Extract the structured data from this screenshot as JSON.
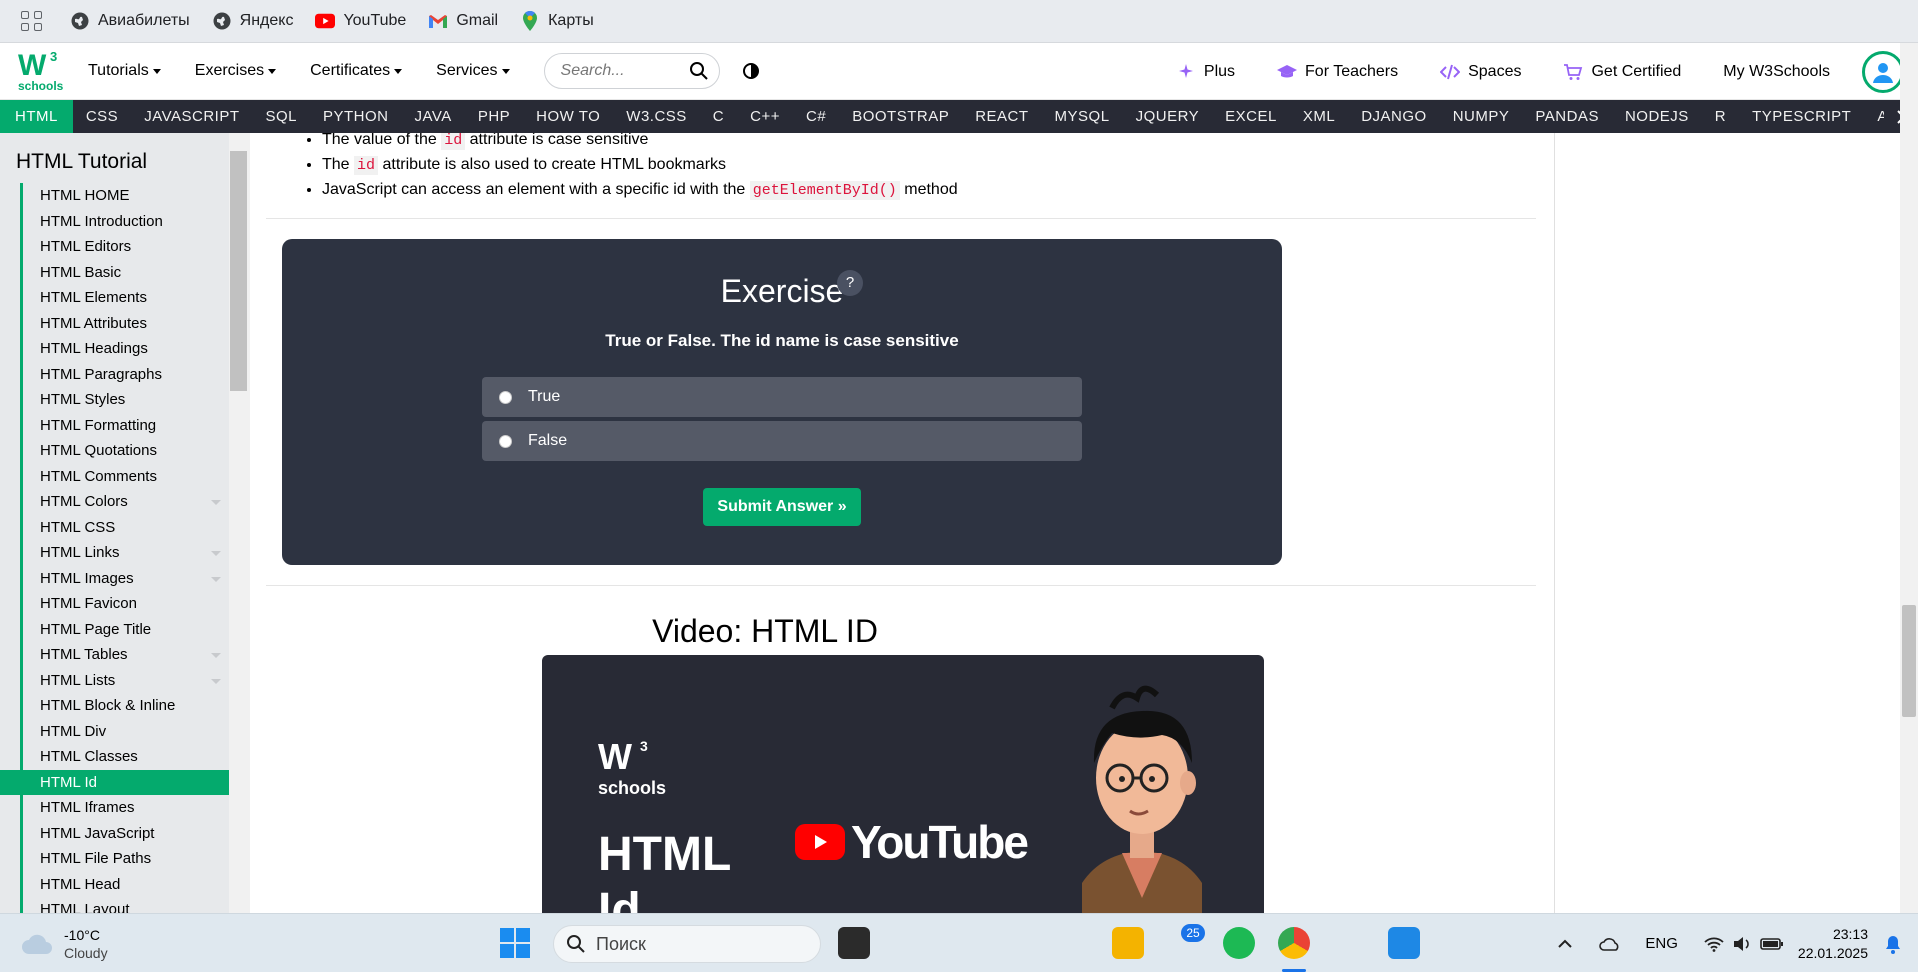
{
  "bookmarks": [
    {
      "label": "Авиабилеты",
      "icon": "globe-icon"
    },
    {
      "label": "Яндекс",
      "icon": "globe-icon"
    },
    {
      "label": "YouTube",
      "icon": "youtube-icon"
    },
    {
      "label": "Gmail",
      "icon": "gmail-icon"
    },
    {
      "label": "Карты",
      "icon": "maps-pin-icon"
    }
  ],
  "topnav": {
    "menus": [
      "Tutorials",
      "Exercises",
      "Certificates",
      "Services"
    ],
    "search_placeholder": "Search...",
    "right": [
      "Plus",
      "For Teachers",
      "Spaces",
      "Get Certified",
      "My W3Schools"
    ]
  },
  "subjects": [
    "HTML",
    "CSS",
    "JAVASCRIPT",
    "SQL",
    "PYTHON",
    "JAVA",
    "PHP",
    "HOW TO",
    "W3.CSS",
    "C",
    "C++",
    "C#",
    "BOOTSTRAP",
    "REACT",
    "MYSQL",
    "JQUERY",
    "EXCEL",
    "XML",
    "DJANGO",
    "NUMPY",
    "PANDAS",
    "NODEJS",
    "R",
    "TYPESCRIPT",
    "A"
  ],
  "sidebar": {
    "title": "HTML Tutorial",
    "items": [
      "HTML HOME",
      "HTML Introduction",
      "HTML Editors",
      "HTML Basic",
      "HTML Elements",
      "HTML Attributes",
      "HTML Headings",
      "HTML Paragraphs",
      "HTML Styles",
      "HTML Formatting",
      "HTML Quotations",
      "HTML Comments",
      "HTML Colors",
      "HTML CSS",
      "HTML Links",
      "HTML Images",
      "HTML Favicon",
      "HTML Page Title",
      "HTML Tables",
      "HTML Lists",
      "HTML Block & Inline",
      "HTML Div",
      "HTML Classes",
      "HTML Id",
      "HTML Iframes",
      "HTML JavaScript",
      "HTML File Paths",
      "HTML Head",
      "HTML Layout"
    ],
    "active": "HTML Id",
    "expandable": [
      "HTML Colors",
      "HTML Links",
      "HTML Images",
      "HTML Tables",
      "HTML Lists"
    ]
  },
  "content": {
    "bullet1_pre": "The value of the ",
    "bullet1_code": "id",
    "bullet1_post": " attribute is case sensitive",
    "bullet2_pre": "The ",
    "bullet2_code": "id",
    "bullet2_post": " attribute is also used to create HTML bookmarks",
    "bullet3_pre": "JavaScript can access an element with a specific id with the ",
    "bullet3_code": "getElementById()",
    "bullet3_post": " method"
  },
  "exercise": {
    "title": "Exercise",
    "help": "?",
    "question": "True or False. The id name is case sensitive",
    "options": [
      "True",
      "False"
    ],
    "submit": "Submit Answer »"
  },
  "video": {
    "title": "Video: HTML ID",
    "logo_text": "schools",
    "heading": "HTML Id",
    "yt_text": "YouTube"
  },
  "taskbar": {
    "temp": "-10°C",
    "weather": "Cloudy",
    "search": "Поиск",
    "badge": "25",
    "lang": "ENG",
    "time": "23:13",
    "date": "22.01.2025"
  },
  "colors": {
    "brand": "#04aa6d",
    "subject_bar": "#282a35",
    "exercise_bg": "#2d3341"
  }
}
